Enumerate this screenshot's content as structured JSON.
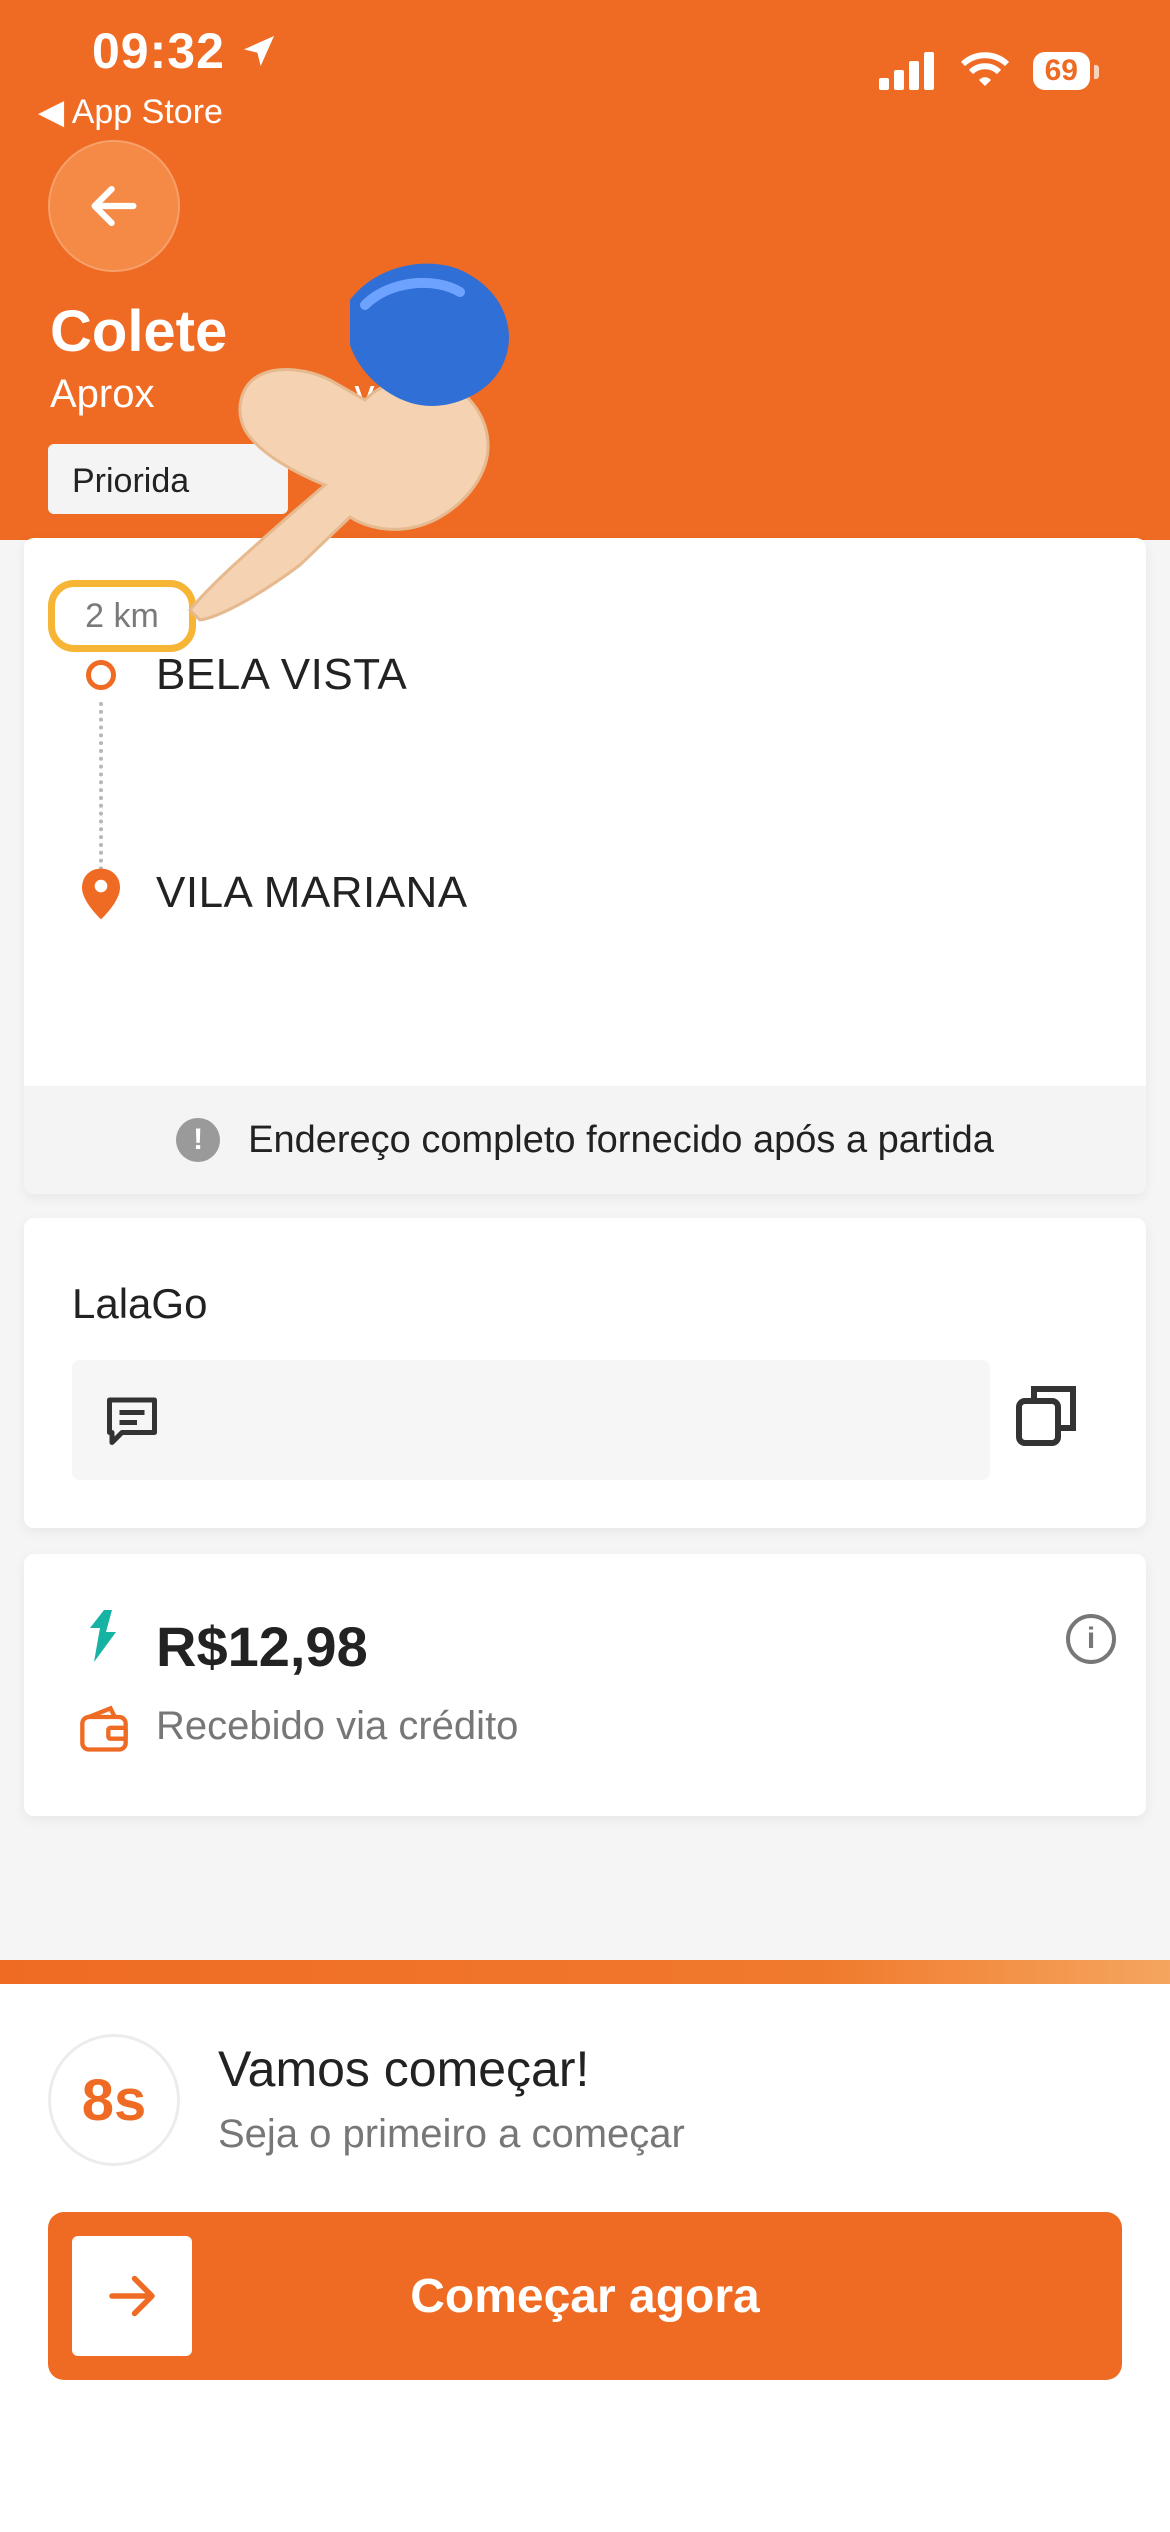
{
  "status_bar": {
    "time": "09:32",
    "back_app": "◀ App Store",
    "battery": "69"
  },
  "header": {
    "title": "Colete",
    "subtitle": "Aprox               e você",
    "priority_label": "Priorida"
  },
  "route": {
    "distance": "2 km",
    "origin": "BELA VISTA",
    "destination": "VILA MARIANA",
    "note": "Endereço completo fornecido após a partida"
  },
  "provider": {
    "name": "LalaGo"
  },
  "payment": {
    "price": "R$12,98",
    "method": "Recebido via crédito"
  },
  "start": {
    "timer": "8s",
    "title": "Vamos começar!",
    "subtitle": "Seja o primeiro a começar",
    "button_label": "Começar agora"
  },
  "colors": {
    "accent": "#ef6b24",
    "highlight": "#f6b535"
  }
}
